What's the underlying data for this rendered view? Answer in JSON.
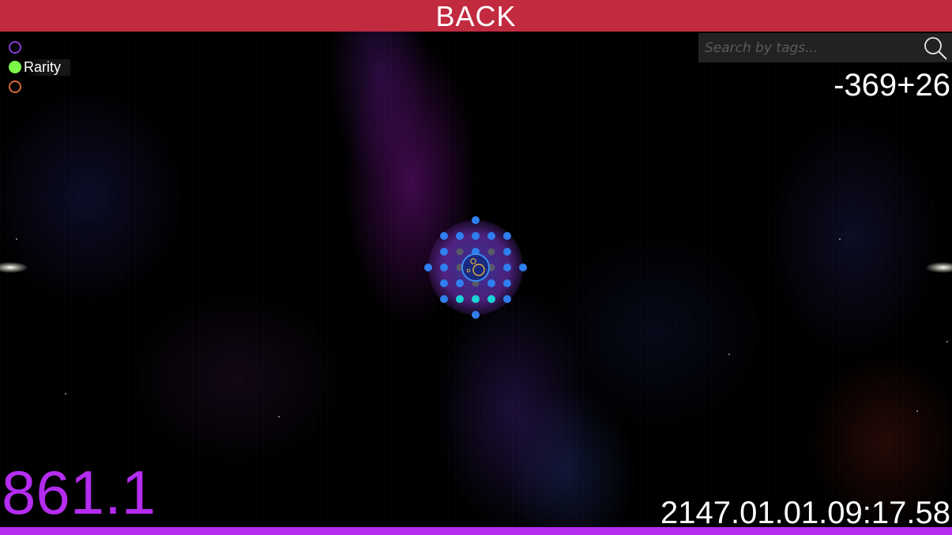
{
  "top_bar": {
    "back_label": "BACK",
    "color": "#c22a3f"
  },
  "legend": {
    "items": [
      {
        "label": "",
        "color": "#8a3bd6",
        "filled": false
      },
      {
        "label": "Rarity",
        "color": "#7cfa4a",
        "filled": true
      },
      {
        "label": "",
        "color": "#d86a38",
        "filled": false
      }
    ]
  },
  "search": {
    "placeholder": "Search by tags...",
    "value": "",
    "icon": "search-icon"
  },
  "coordinates": "-369+26",
  "score": {
    "value": "861.1",
    "color": "#b42cf0"
  },
  "timestamp": "2147.01.01.09:17.58",
  "bottom_strip": {
    "color": "#b42cf0"
  },
  "star_system": {
    "halo_color": "#7a2fb4",
    "ring_color": "#3a6fe0",
    "core_color": "#e3b03a"
  }
}
